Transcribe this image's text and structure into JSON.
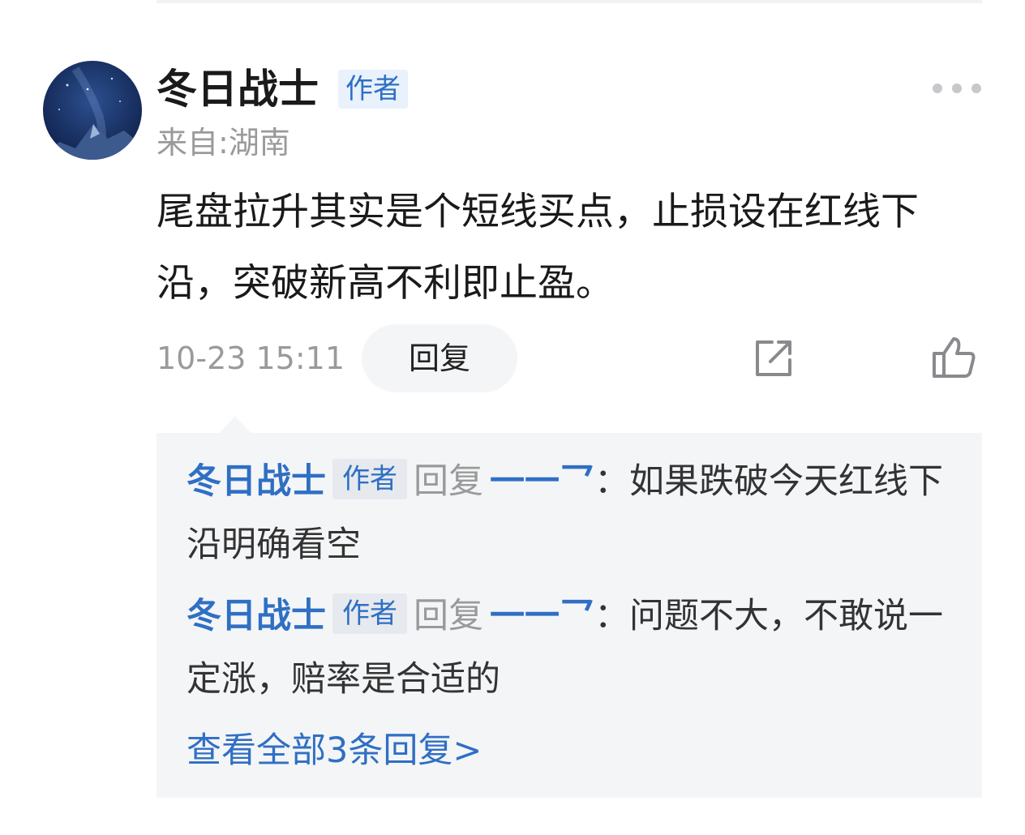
{
  "comment": {
    "author": "冬日战士",
    "author_badge": "作者",
    "location": "来自:湖南",
    "text": "尾盘拉升其实是个短线买点，止损设在红线下沿，突破新高不利即止盈。",
    "timestamp": "10-23 15:11",
    "reply_label": "回复",
    "icons": {
      "more": "more-icon",
      "share": "share-icon",
      "like": "like-icon"
    }
  },
  "replies": [
    {
      "name": "冬日战士",
      "badge": "作者",
      "verb": "回复",
      "target": "一一乛",
      "text": "：如果跌破今天红线下沿明确看空"
    },
    {
      "name": "冬日战士",
      "badge": "作者",
      "verb": "回复",
      "target": "一一乛",
      "text": "：问题不大，不敢说一定涨，赔率是合适的"
    }
  ],
  "view_all": "查看全部3条回复>",
  "colors": {
    "accent_blue": "#2f6fc4",
    "muted_gray": "#9a9a9a",
    "reply_bg": "#f4f5f7"
  }
}
